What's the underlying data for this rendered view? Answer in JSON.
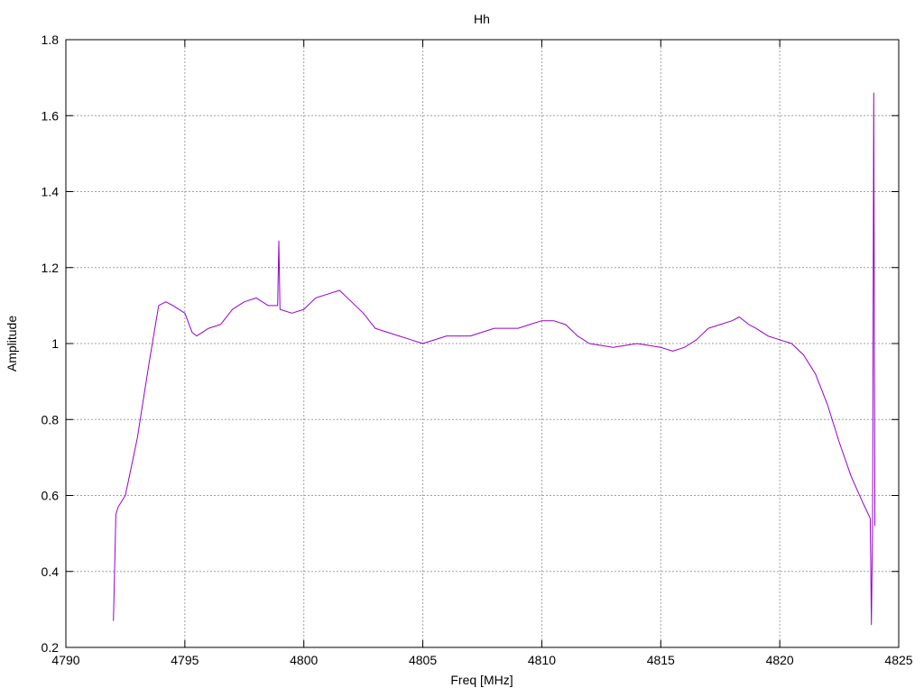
{
  "chart_data": {
    "type": "line",
    "title": "Hh",
    "xlabel": "Freq [MHz]",
    "ylabel": "Amplitude",
    "xlim": [
      4790,
      4825
    ],
    "ylim": [
      0.2,
      1.8
    ],
    "x_ticks": [
      "4790",
      "4795",
      "4800",
      "4805",
      "4810",
      "4815",
      "4820",
      "4825"
    ],
    "y_ticks": [
      "0.2",
      "0.4",
      "0.6",
      "0.8",
      "1",
      "1.2",
      "1.4",
      "1.6",
      "1.8"
    ],
    "grid": true,
    "line_color": "#9400d3",
    "series": [
      {
        "x": [
          4792.0,
          4792.1,
          4792.2,
          4792.5,
          4793.0,
          4793.5,
          4793.9,
          4794.2,
          4794.5,
          4795.0,
          4795.3,
          4795.5,
          4796.0,
          4796.5,
          4797.0,
          4797.5,
          4798.0,
          4798.5,
          4798.9,
          4798.95,
          4799.0,
          4799.5,
          4800.0,
          4800.5,
          4801.0,
          4801.5,
          4802.0,
          4802.5,
          4803.0,
          4803.5,
          4804.0,
          4804.5,
          4805.0,
          4806.0,
          4807.0,
          4808.0,
          4808.5,
          4809.0,
          4809.5,
          4810.0,
          4810.5,
          4811.0,
          4811.5,
          4812.0,
          4813.0,
          4814.0,
          4815.0,
          4815.5,
          4816.0,
          4816.5,
          4817.0,
          4817.5,
          4818.0,
          4818.3,
          4818.7,
          4819.0,
          4819.5,
          4820.0,
          4820.5,
          4821.0,
          4821.5,
          4822.0,
          4822.5,
          4823.0,
          4823.5,
          4823.8,
          4823.85,
          4823.9,
          4823.95,
          4824.0
        ],
        "y": [
          0.27,
          0.55,
          0.57,
          0.6,
          0.75,
          0.95,
          1.1,
          1.11,
          1.1,
          1.08,
          1.03,
          1.02,
          1.04,
          1.05,
          1.09,
          1.11,
          1.12,
          1.1,
          1.1,
          1.27,
          1.09,
          1.08,
          1.09,
          1.12,
          1.13,
          1.14,
          1.11,
          1.08,
          1.04,
          1.03,
          1.02,
          1.01,
          1.0,
          1.02,
          1.02,
          1.04,
          1.04,
          1.04,
          1.05,
          1.06,
          1.06,
          1.05,
          1.02,
          1.0,
          0.99,
          1.0,
          0.99,
          0.98,
          0.99,
          1.01,
          1.04,
          1.05,
          1.06,
          1.07,
          1.05,
          1.04,
          1.02,
          1.01,
          1.0,
          0.97,
          0.92,
          0.84,
          0.74,
          0.65,
          0.58,
          0.54,
          0.26,
          0.52,
          1.66,
          0.52
        ]
      }
    ]
  }
}
